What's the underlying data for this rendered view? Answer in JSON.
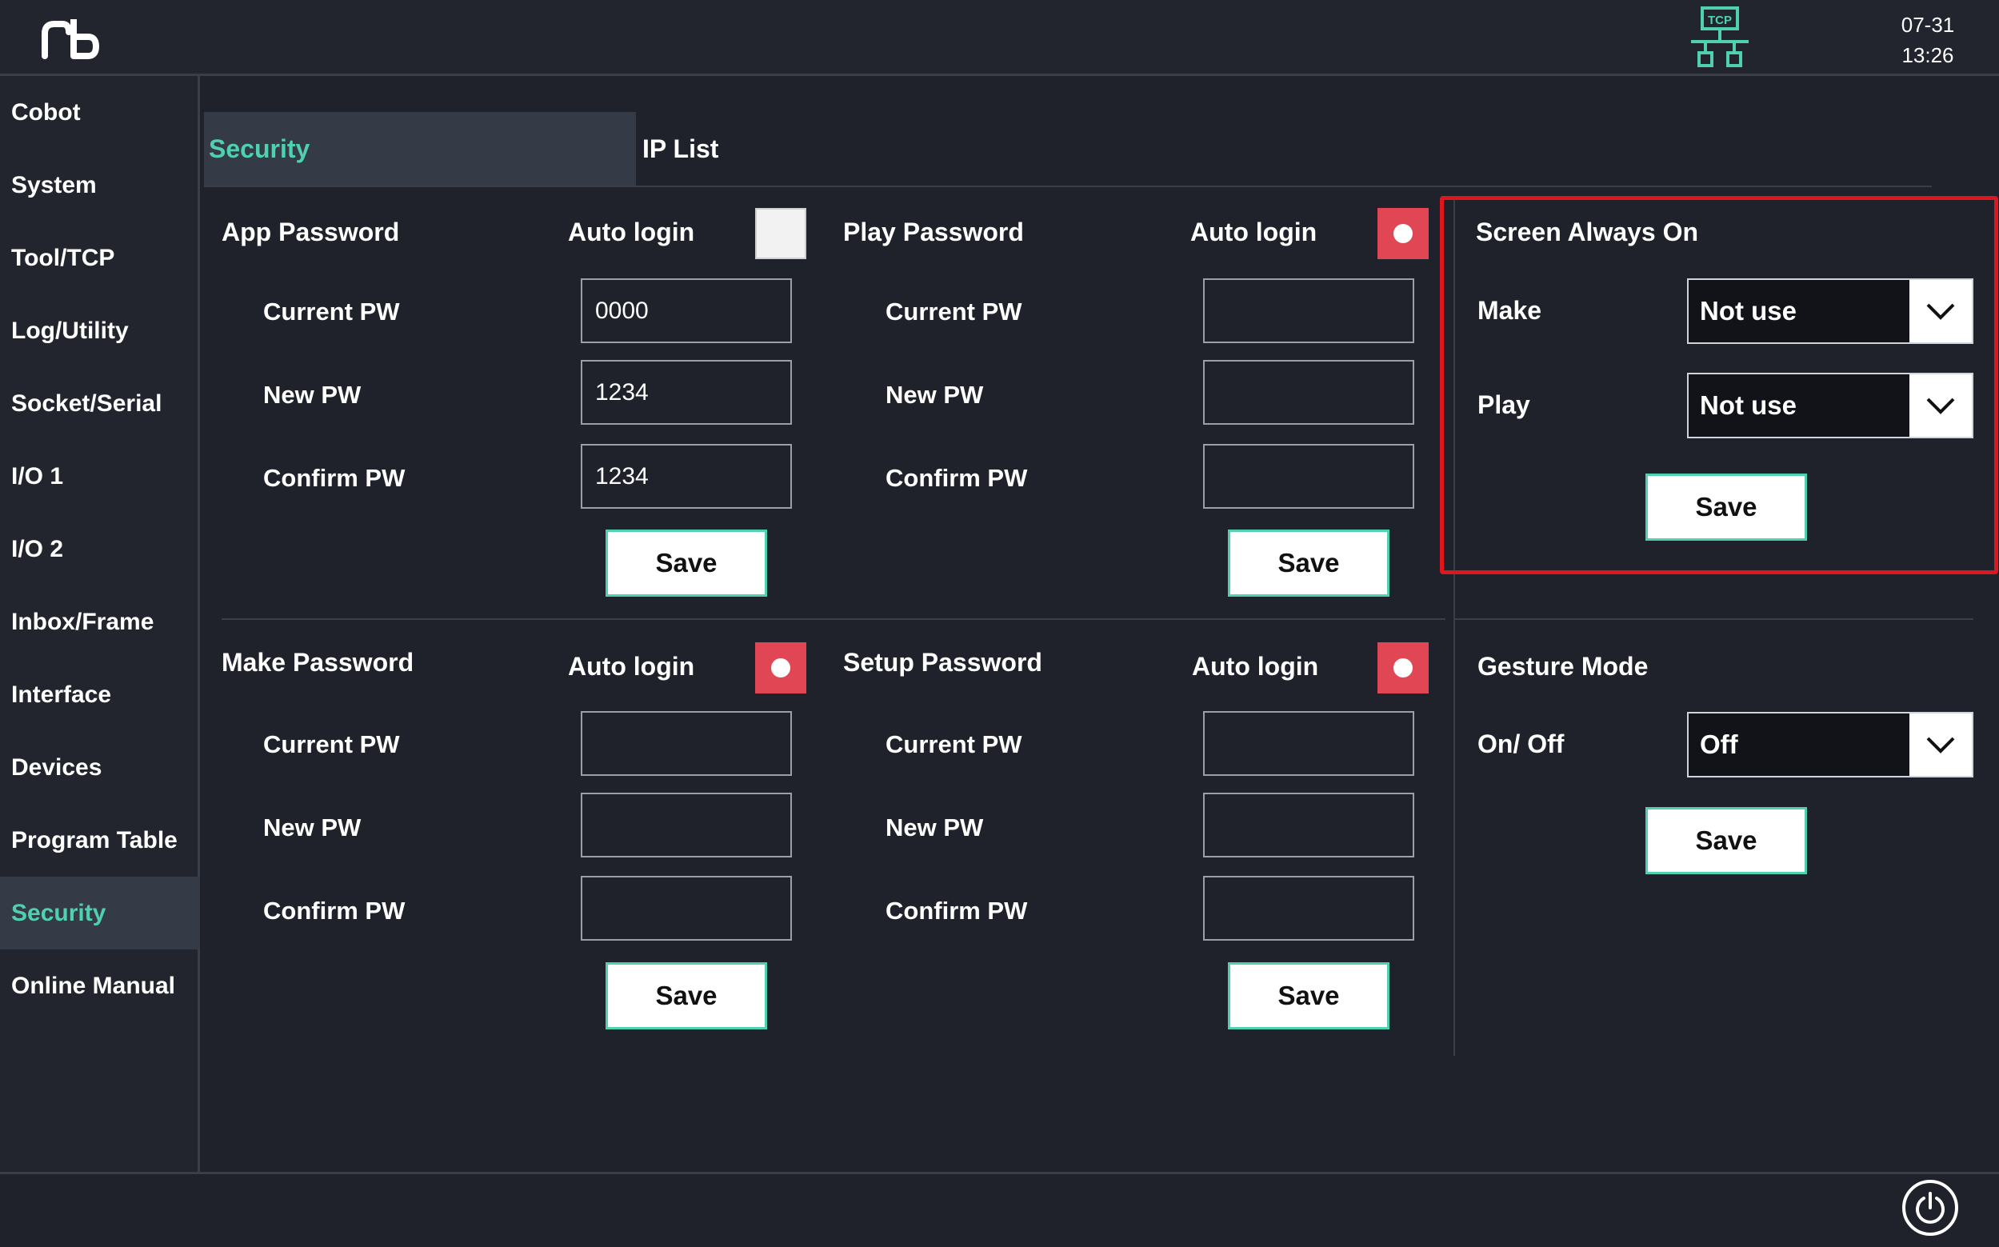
{
  "header": {
    "date": "07-31",
    "time": "13:26",
    "network_label": "TCP"
  },
  "sidebar": {
    "items": [
      {
        "label": "Cobot"
      },
      {
        "label": "System"
      },
      {
        "label": "Tool/TCP"
      },
      {
        "label": "Log/Utility"
      },
      {
        "label": "Socket/Serial"
      },
      {
        "label": "I/O 1"
      },
      {
        "label": "I/O 2"
      },
      {
        "label": "Inbox/Frame"
      },
      {
        "label": "Interface"
      },
      {
        "label": "Devices"
      },
      {
        "label": "Program Table"
      },
      {
        "label": "Security"
      },
      {
        "label": "Online Manual"
      }
    ],
    "active": "Security"
  },
  "tabs": {
    "security": "Security",
    "ip_list": "IP List",
    "active": "Security"
  },
  "app_password": {
    "title": "App Password",
    "auto_login_label": "Auto login",
    "auto_login": false,
    "current_label": "Current PW",
    "new_label": "New PW",
    "confirm_label": "Confirm PW",
    "current_value": "0000",
    "new_value": "1234",
    "confirm_value": "1234",
    "save_label": "Save"
  },
  "play_password": {
    "title": "Play Password",
    "auto_login_label": "Auto login",
    "auto_login": true,
    "current_label": "Current PW",
    "new_label": "New PW",
    "confirm_label": "Confirm PW",
    "current_value": "",
    "new_value": "",
    "confirm_value": "",
    "save_label": "Save"
  },
  "make_password": {
    "title": "Make Password",
    "auto_login_label": "Auto login",
    "auto_login": true,
    "current_label": "Current PW",
    "new_label": "New PW",
    "confirm_label": "Confirm PW",
    "current_value": "",
    "new_value": "",
    "confirm_value": "",
    "save_label": "Save"
  },
  "setup_password": {
    "title": "Setup Password",
    "auto_login_label": "Auto login",
    "auto_login": true,
    "current_label": "Current PW",
    "new_label": "New PW",
    "confirm_label": "Confirm PW",
    "current_value": "",
    "new_value": "",
    "confirm_value": "",
    "save_label": "Save"
  },
  "screen_always_on": {
    "title": "Screen Always On",
    "make_label": "Make",
    "make_value": "Not use",
    "play_label": "Play",
    "play_value": "Not use",
    "save_label": "Save"
  },
  "gesture_mode": {
    "title": "Gesture Mode",
    "onoff_label": "On/ Off",
    "onoff_value": "Off",
    "save_label": "Save"
  },
  "colors": {
    "accent": "#4fd1b0",
    "toggle_on": "#e04654",
    "highlight": "#e0161f",
    "background": "#1f222b"
  },
  "icons": {
    "logo": "rb-logo",
    "network": "tcp-network-icon",
    "power": "power-icon",
    "dropdown": "chevron-down-icon"
  }
}
